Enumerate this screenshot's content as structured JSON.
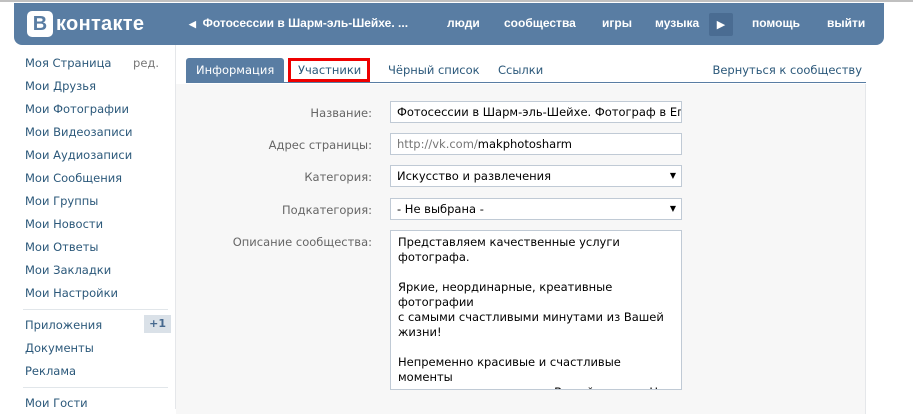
{
  "header": {
    "logo_letter": "В",
    "logo_text": "контакте",
    "back_label": "Фотосессии в Шарм-эль-Шейхе. ...",
    "nav": [
      "люди",
      "сообщества",
      "игры",
      "музыка"
    ],
    "more_icon": "play-right-icon",
    "nav_right": [
      "помощь",
      "выйти"
    ]
  },
  "sidebar": {
    "items": [
      {
        "label": "Моя Страница",
        "extra": "ред."
      },
      {
        "label": "Мои Друзья"
      },
      {
        "label": "Мои Фотографии"
      },
      {
        "label": "Мои Видеозаписи"
      },
      {
        "label": "Мои Аудиозаписи"
      },
      {
        "label": "Мои Сообщения"
      },
      {
        "label": "Мои Группы"
      },
      {
        "label": "Мои Новости"
      },
      {
        "label": "Мои Ответы"
      },
      {
        "label": "Мои Закладки"
      },
      {
        "label": "Мои Настройки"
      }
    ],
    "apps": [
      {
        "label": "Приложения",
        "badge": "+1"
      },
      {
        "label": "Документы"
      },
      {
        "label": "Реклама"
      }
    ],
    "guests": "Мои Гости"
  },
  "tabs": {
    "items": [
      "Информация",
      "Участники",
      "Чёрный список",
      "Ссылки"
    ],
    "back": "Вернуться к сообществу"
  },
  "form": {
    "name_label": "Название:",
    "name_value": "Фотосессии в Шарм-эль-Шейхе. Фотограф в Египте",
    "address_label": "Адрес страницы:",
    "address_prefix": "http://vk.com/",
    "address_value": "makphotosharm",
    "category_label": "Категория:",
    "category_value": "Искусство и развлечения",
    "subcategory_label": "Подкатегория:",
    "subcategory_value": "- Не выбрана -",
    "description_label": "Описание сообщества:",
    "description_value": "Представляем качественные услуги\nфотографа.\n\nЯркие, неординарные, креативные фотографии\nс самыми счастливыми минутами из Вашей\nжизни!\n\nНепременно красивые и счастливые моменты\nзакрадываются далеко в Вашей памяти. Но\nиногда так хочется вернуться обратно,\nпоэтому чаще всего мы пересматриваем\nфотокарточки с яркими  теплыми и милыми\nмоментами!"
  }
}
